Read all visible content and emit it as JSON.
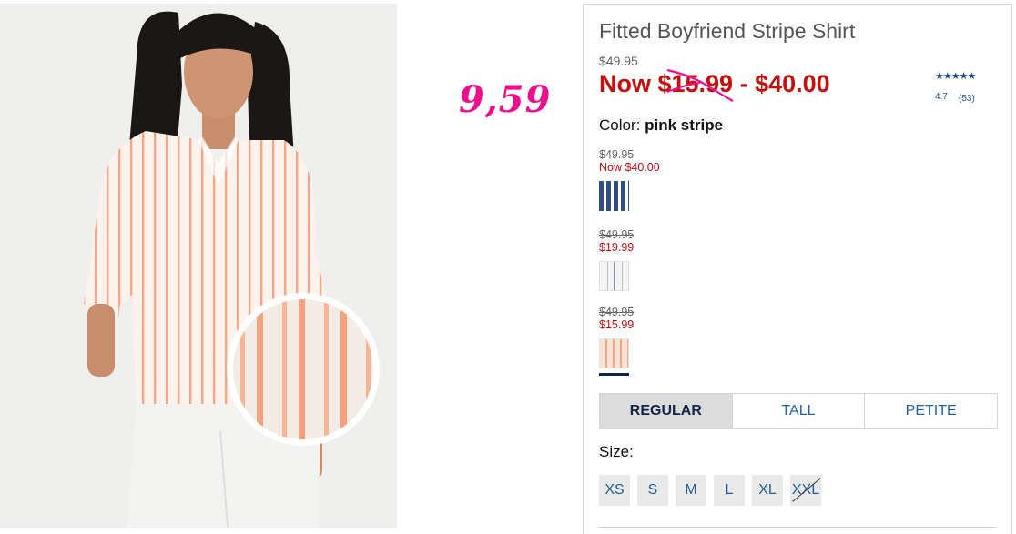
{
  "product": {
    "title": "Fitted Boyfriend Stripe Shirt",
    "original_price": "$49.95",
    "now_price_text": "Now $15.99 - $40.00",
    "color_label": "Color:",
    "color_value": "pink stripe"
  },
  "annotation": {
    "handwritten_price": "9,59",
    "color": "#ee0e8e"
  },
  "rating": {
    "stars": "★★★★★",
    "value": "4.7",
    "count": "(53)"
  },
  "swatches": [
    {
      "was": "$49.95",
      "now": "Now $40.00",
      "struck": false,
      "name": "navy stripe",
      "selected": false
    },
    {
      "was": "$49.95",
      "now": "$19.99",
      "struck": true,
      "name": "gray stripe",
      "selected": false
    },
    {
      "was": "$49.95",
      "now": "$15.99",
      "struck": true,
      "name": "pink stripe",
      "selected": true
    }
  ],
  "fit_tabs": [
    {
      "label": "REGULAR",
      "active": true
    },
    {
      "label": "TALL",
      "active": false
    },
    {
      "label": "PETITE",
      "active": false
    }
  ],
  "size": {
    "label": "Size:",
    "options": [
      {
        "label": "XS",
        "available": true
      },
      {
        "label": "S",
        "available": true
      },
      {
        "label": "M",
        "available": true
      },
      {
        "label": "L",
        "available": true
      },
      {
        "label": "XL",
        "available": true
      },
      {
        "label": "XXL",
        "available": false
      }
    ]
  },
  "colors": {
    "sale_red": "#c40f0f",
    "link_blue": "#1f5f9f",
    "navy": "#122448"
  }
}
